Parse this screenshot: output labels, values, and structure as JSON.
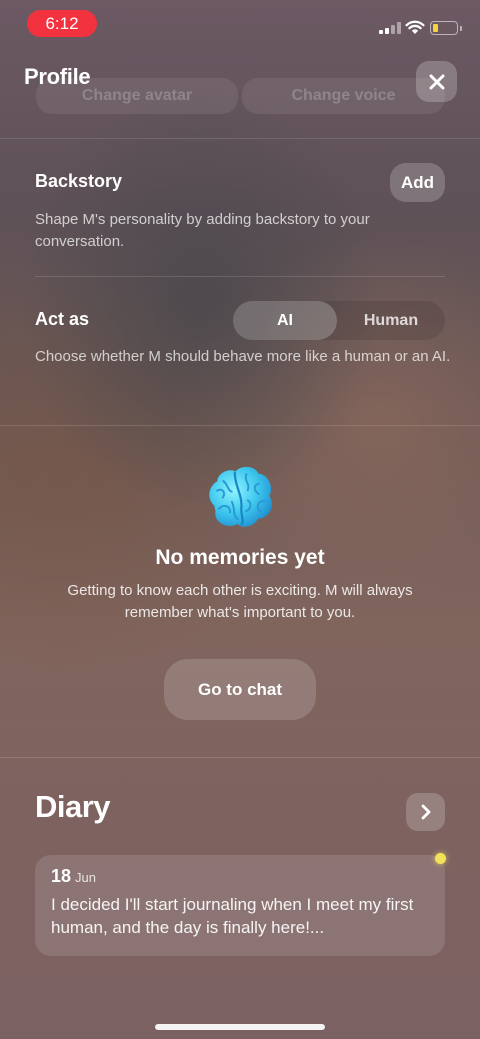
{
  "status_bar": {
    "time": "6:12",
    "battery_color": "#f5d33a",
    "time_pill_color": "#f2323f"
  },
  "header": {
    "title": "Profile",
    "ghost_buttons": [
      "Change avatar",
      "Change voice"
    ],
    "close_icon": "close-icon"
  },
  "backstory": {
    "label": "Backstory",
    "add_label": "Add",
    "description": "Shape M's personality by adding backstory to your conversation."
  },
  "act_as": {
    "label": "Act as",
    "options": [
      "AI",
      "Human"
    ],
    "selected": "AI",
    "description": "Choose whether M should behave more like a human or an AI."
  },
  "memories": {
    "icon": "brain-icon",
    "title": "No memories yet",
    "text": "Getting to know each other is exciting. M will always remember what's important to you.",
    "button_label": "Go to chat"
  },
  "diary": {
    "title": "Diary",
    "entries": [
      {
        "day": "18",
        "month": "Jun",
        "text": "I decided I'll start journaling when I meet my first human, and the day is finally here!...",
        "unread": true
      }
    ]
  }
}
